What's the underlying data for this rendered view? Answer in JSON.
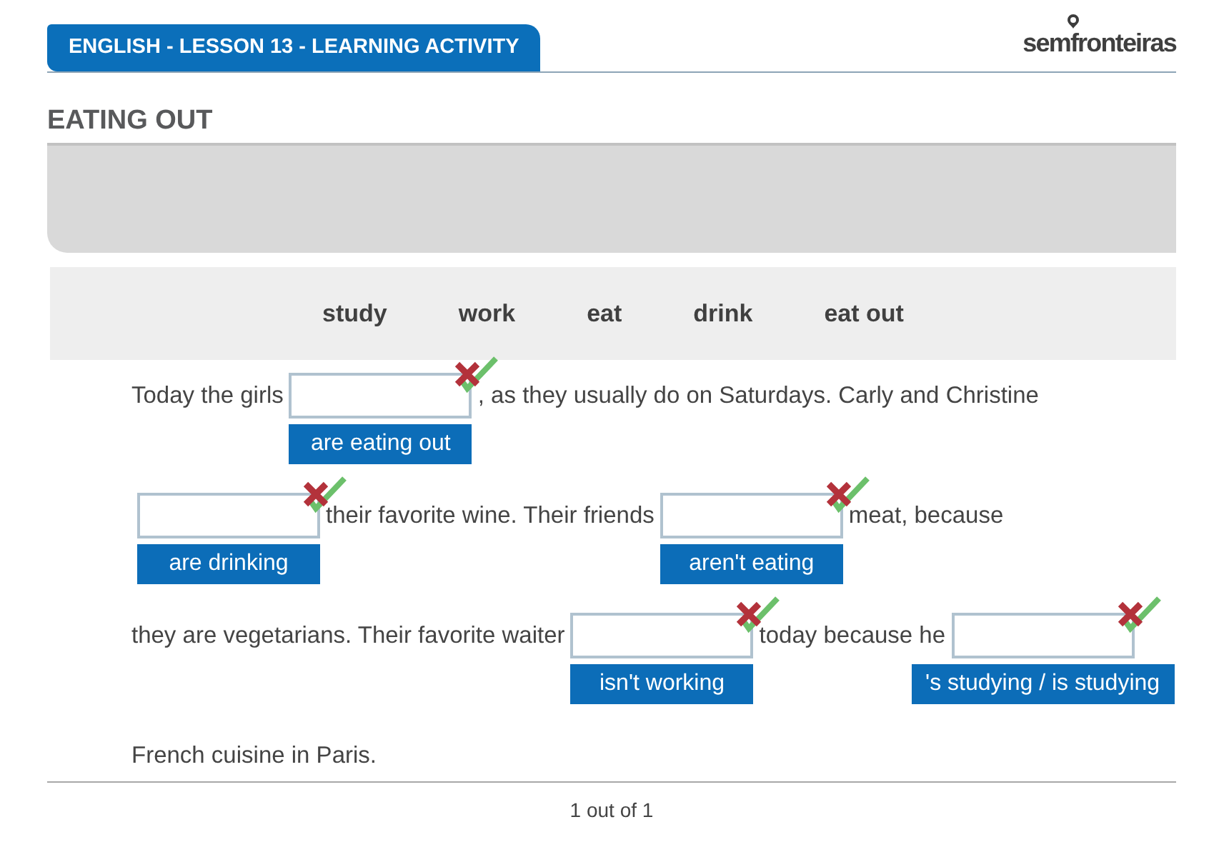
{
  "header": {
    "title": "ENGLISH - LESSON 13 - LEARNING ACTIVITY",
    "logo": "semfronteiras"
  },
  "activity": {
    "title": "EATING OUT"
  },
  "word_bank": [
    "study",
    "work",
    "eat",
    "drink",
    "eat out"
  ],
  "lines": [
    [
      {
        "kind": "text",
        "text": "Today the girls"
      },
      {
        "kind": "blank",
        "answer": "are eating out"
      },
      {
        "kind": "text",
        "text": ", as they usually do on Saturdays. Carly and Christine"
      }
    ],
    [
      {
        "kind": "blank",
        "answer": "are drinking"
      },
      {
        "kind": "text",
        "text": "their favorite wine. Their friends"
      },
      {
        "kind": "blank",
        "answer": "aren't eating"
      },
      {
        "kind": "text",
        "text": "meat, because"
      }
    ],
    [
      {
        "kind": "text",
        "text": "they are vegetarians. Their favorite waiter"
      },
      {
        "kind": "blank",
        "answer": "isn't working"
      },
      {
        "kind": "text",
        "text": "today because he"
      },
      {
        "kind": "blank",
        "answer": "'s studying / is studying"
      }
    ],
    [
      {
        "kind": "text",
        "text": "French cuisine in Paris."
      }
    ]
  ],
  "pager": "1 out of 1"
}
